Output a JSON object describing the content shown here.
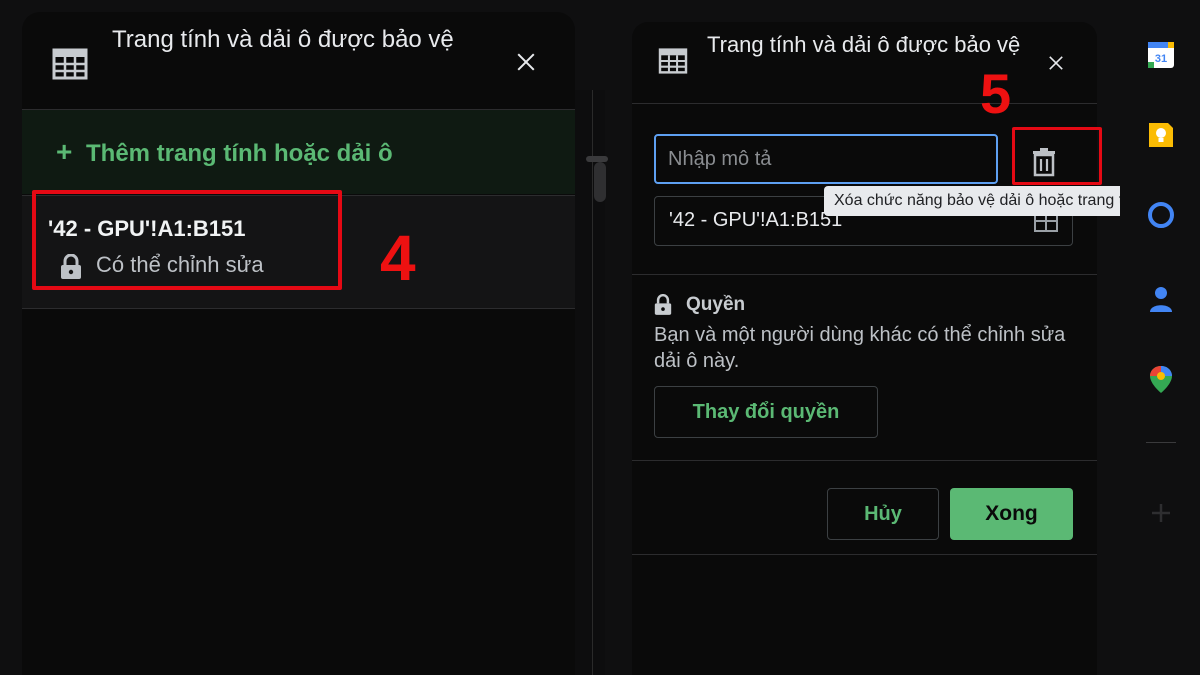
{
  "left_panel": {
    "title": "Trang tính và dải ô được bảo vệ",
    "add_label": "Thêm trang tính hoặc dải ô",
    "add_plus": "+",
    "item": {
      "range": "'42 - GPU'!A1:B151",
      "permission": "Có thể chỉnh sửa"
    },
    "step_number": "4"
  },
  "right_panel": {
    "title": "Trang tính và dải ô được bảo vệ",
    "description_placeholder": "Nhập mô tả",
    "description_value": "",
    "range_value": "'42 - GPU'!A1:B151",
    "delete_tooltip": "Xóa chức năng bảo vệ dải ô hoặc trang tính",
    "permissions_heading": "Quyền",
    "permissions_text": "Bạn và một người dùng khác có thể chỉnh sửa dải ô này.",
    "change_permissions_label": "Thay đổi quyền",
    "cancel_label": "Hủy",
    "done_label": "Xong",
    "step_number": "5"
  },
  "side_rail": {
    "icons": [
      "calendar-icon",
      "keep-icon",
      "tasks-icon",
      "contacts-icon",
      "maps-icon",
      "add-icon"
    ],
    "calendar_day": "31"
  },
  "colors": {
    "accent_green": "#5bb974",
    "focus_blue": "#5ea0f2",
    "highlight_red": "#e50914",
    "background": "#0a0a0a"
  }
}
